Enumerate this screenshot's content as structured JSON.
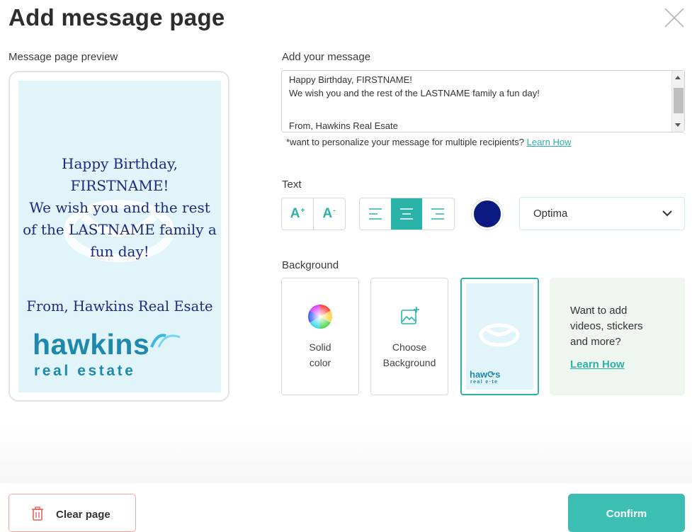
{
  "dialog": {
    "title": "Add message page"
  },
  "preview": {
    "label": "Message page preview",
    "message_lines": [
      "Happy Birthday,",
      "FIRSTNAME!",
      "We wish you and the rest",
      "of the LASTNAME family a",
      "fun day!"
    ],
    "from_line": "From, Hawkins Real Esate",
    "logo_word": "hawkins",
    "logo_sub": "real estate",
    "card_bg": "#e1f4fa",
    "text_color": "#1a2a80"
  },
  "message": {
    "label": "Add your message",
    "lines": [
      "Happy Birthday, FIRSTNAME!",
      "We wish you and the rest of the LASTNAME family a fun day!",
      "",
      "From, Hawkins Real Esate"
    ],
    "hint": "*want to personalize your message for multiple recipients?",
    "hint_link": "Learn How"
  },
  "text_controls": {
    "label": "Text",
    "size_increase": "A",
    "size_increase_sup": "+",
    "size_decrease": "A",
    "size_decrease_sup": "-",
    "alignment_active": "center",
    "color": "#0b1a80",
    "font": "Optima"
  },
  "background": {
    "label": "Background",
    "solid_color_lines": [
      "Solid",
      "color"
    ],
    "choose_lines": [
      "Choose",
      "Background"
    ],
    "selected_thumb_word": "haw",
    "selected_thumb_word_tail": "s",
    "selected_thumb_sub": "real e",
    "selected_thumb_sub_tail": "te",
    "promo_lines": [
      "Want to add",
      "videos, stickers",
      "and more?"
    ],
    "promo_link": "Learn How"
  },
  "footer": {
    "clear_label": "Clear page",
    "confirm_label": "Confirm"
  },
  "colors": {
    "accent": "#2ab3a8",
    "confirm": "#3cbfb2",
    "danger_border": "#f0a7a0"
  }
}
